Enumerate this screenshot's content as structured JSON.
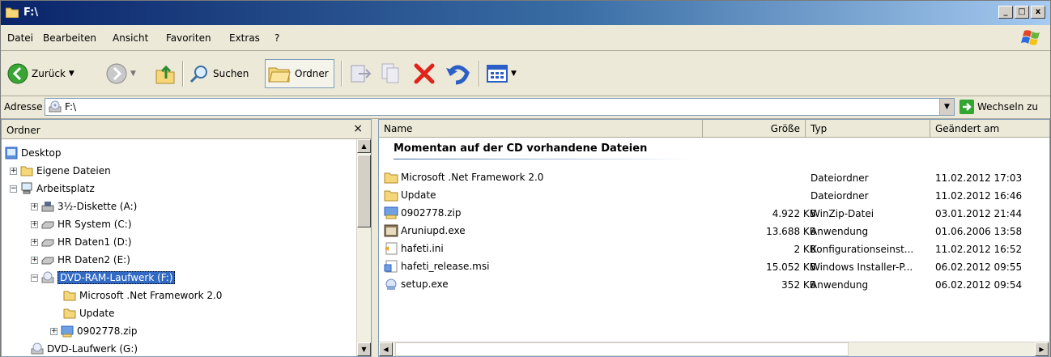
{
  "window": {
    "title": "F:\\"
  },
  "titlebar_buttons": {
    "minimize": "_",
    "maximize": "□",
    "close": "x"
  },
  "menu": [
    {
      "label": "Datei"
    },
    {
      "label": "Bearbeiten"
    },
    {
      "label": "Ansicht"
    },
    {
      "label": "Favoriten"
    },
    {
      "label": "Extras"
    },
    {
      "label": "?"
    }
  ],
  "toolbar": {
    "back_label": "Zurück",
    "search_label": "Suchen",
    "folders_label": "Ordner"
  },
  "address": {
    "label": "Adresse",
    "value": "F:\\",
    "go_label": "Wechseln zu"
  },
  "tree": {
    "header": "Ordner",
    "close": "×",
    "nodes": [
      {
        "label": "Desktop"
      },
      {
        "label": "Eigene Dateien",
        "expander": "+"
      },
      {
        "label": "Arbeitsplatz",
        "expander": "−"
      },
      {
        "label": "3½-Diskette (A:)",
        "expander": "+"
      },
      {
        "label": "HR System (C:)",
        "expander": "+"
      },
      {
        "label": "HR Daten1 (D:)",
        "expander": "+"
      },
      {
        "label": "HR Daten2 (E:)",
        "expander": "+"
      },
      {
        "label": "DVD-RAM-Laufwerk (F:)",
        "expander": "−"
      },
      {
        "label": "Microsoft .Net Framework 2.0"
      },
      {
        "label": "Update"
      },
      {
        "label": "0902778.zip",
        "expander": "+"
      },
      {
        "label": "DVD-Laufwerk (G:)"
      }
    ]
  },
  "list": {
    "columns": {
      "name": "Name",
      "size": "Größe",
      "type": "Typ",
      "modified": "Geändert am"
    },
    "group_title": "Momentan auf der CD vorhandene Dateien",
    "rows": [
      {
        "name": "Microsoft .Net Framework 2.0",
        "size": "",
        "type": "Dateiordner",
        "modified": "11.02.2012 17:03",
        "icon": "folder"
      },
      {
        "name": "Update",
        "size": "",
        "type": "Dateiordner",
        "modified": "11.02.2012 16:46",
        "icon": "folder"
      },
      {
        "name": "0902778.zip",
        "size": "4.922 KB",
        "type": "WinZip-Datei",
        "modified": "03.01.2012 21:44",
        "icon": "zip"
      },
      {
        "name": "Aruniupd.exe",
        "size": "13.688 KB",
        "type": "Anwendung",
        "modified": "01.06.2006 13:58",
        "icon": "exe"
      },
      {
        "name": "hafeti.ini",
        "size": "2 KB",
        "type": "Konfigurationseinst...",
        "modified": "11.02.2012 16:52",
        "icon": "ini"
      },
      {
        "name": "hafeti_release.msi",
        "size": "15.052 KB",
        "type": "Windows Installer-P...",
        "modified": "06.02.2012 09:55",
        "icon": "msi"
      },
      {
        "name": "setup.exe",
        "size": "352 KB",
        "type": "Anwendung",
        "modified": "06.02.2012 09:54",
        "icon": "setup"
      }
    ]
  },
  "colors": {
    "title_start": "#0a246a",
    "title_end": "#a6caf0",
    "selection": "#316ac5",
    "close_red": "#e2231a",
    "go_green": "#33a532"
  }
}
